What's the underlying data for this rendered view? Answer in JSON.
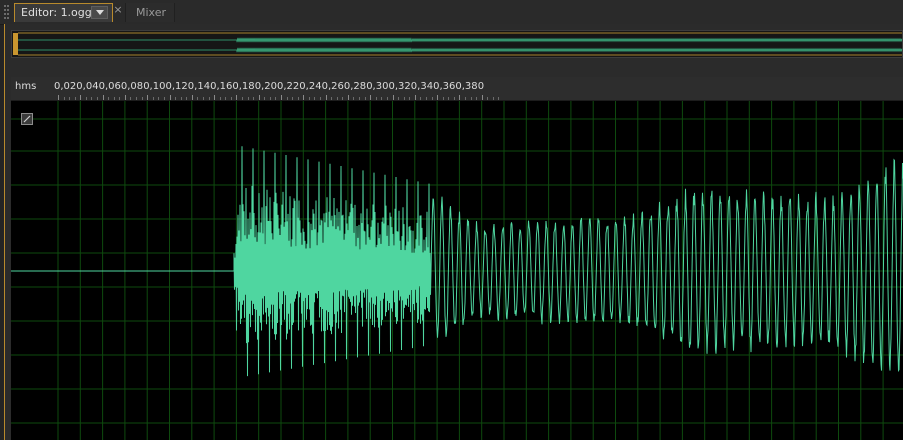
{
  "tabs": [
    {
      "label": "Editor: 1.ogg",
      "active": true
    },
    {
      "label": "Mixer",
      "active": false
    }
  ],
  "close_glyph": "×",
  "ruler": {
    "unit": "hms",
    "ticks": [
      "0,02",
      "0,04",
      "0,06",
      "0,08",
      "0,10",
      "0,12",
      "0,14",
      "0,16",
      "0,18",
      "0,20",
      "0,22",
      "0,24",
      "0,26",
      "0,28",
      "0,30",
      "0,32",
      "0,34",
      "0,36",
      "0,38",
      "0"
    ]
  },
  "colors": {
    "waveform": "#4fd6a0",
    "grid": "#0e4a0e",
    "accent": "#b88a2c",
    "background": "#000000"
  },
  "icons": [
    "grip-icon",
    "dropdown-arrow-icon",
    "close-icon",
    "channel-enable-icon"
  ]
}
